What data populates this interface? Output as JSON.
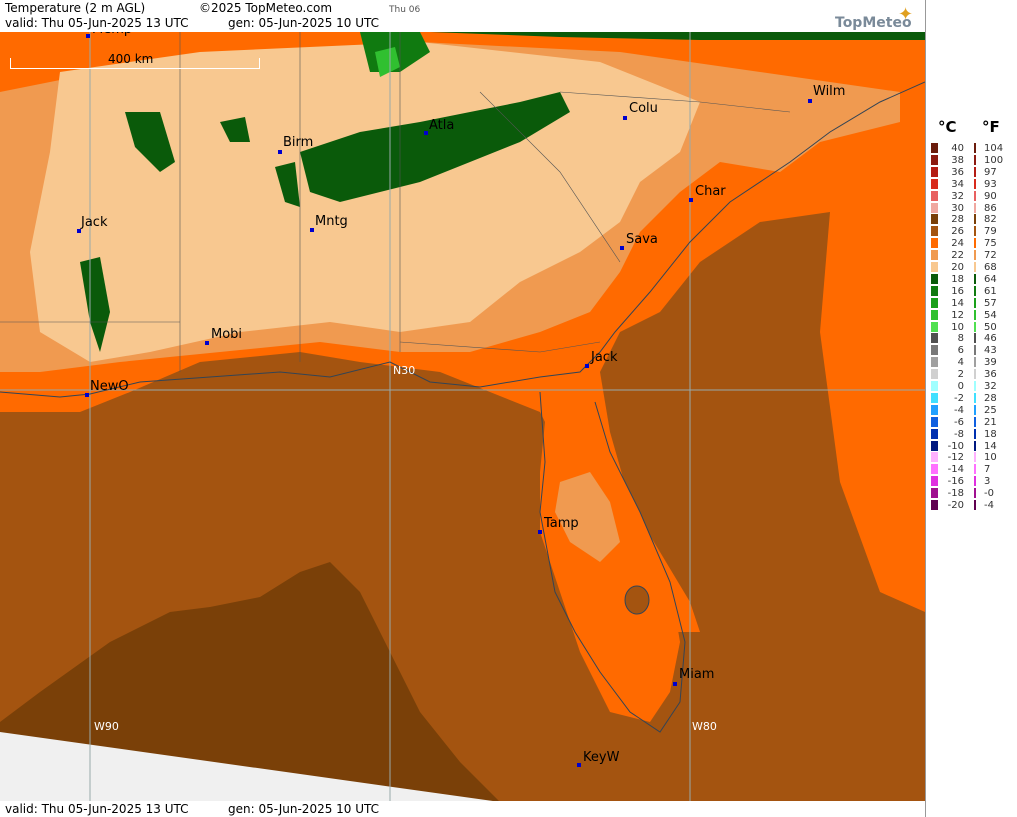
{
  "header": {
    "title": "Temperature (2 m AGL)",
    "copyright": "©2025 TopMeteo.com",
    "day_tab": "Thu 06",
    "valid": "valid:  Thu   05-Jun-2025  13 UTC",
    "generated": "gen:  05-Jun-2025 10 UTC",
    "brand": "TopMeteo"
  },
  "footer": {
    "valid": "valid:  Thu   05-Jun-2025  13 UTC",
    "generated": "gen:  05-Jun-2025 10 UTC"
  },
  "scale": {
    "label": "400 km"
  },
  "grid_labels": {
    "lat30": "N30",
    "lon90": "W90",
    "lon80": "W80"
  },
  "cities": [
    {
      "id": "memp",
      "name": "Memp"
    },
    {
      "id": "birm",
      "name": "Birm"
    },
    {
      "id": "atla",
      "name": "Atla"
    },
    {
      "id": "colu",
      "name": "Colu"
    },
    {
      "id": "wilm",
      "name": "Wilm"
    },
    {
      "id": "char",
      "name": "Char"
    },
    {
      "id": "jack-ms",
      "name": "Jack"
    },
    {
      "id": "mntg",
      "name": "Mntg"
    },
    {
      "id": "sava",
      "name": "Sava"
    },
    {
      "id": "mobi",
      "name": "Mobi"
    },
    {
      "id": "jack-fl",
      "name": "Jack"
    },
    {
      "id": "newo",
      "name": "NewO"
    },
    {
      "id": "tamp",
      "name": "Tamp"
    },
    {
      "id": "miam",
      "name": "Miam"
    },
    {
      "id": "keyw",
      "name": "KeyW"
    }
  ],
  "legend": {
    "unit_c": "°C",
    "unit_f": "°F",
    "rows": [
      {
        "c": "40",
        "f": "104",
        "color": "#6b1c0c"
      },
      {
        "c": "38",
        "f": "100",
        "color": "#8c1a10"
      },
      {
        "c": "36",
        "f": "97",
        "color": "#b41c14"
      },
      {
        "c": "34",
        "f": "93",
        "color": "#d82a1c"
      },
      {
        "c": "32",
        "f": "90",
        "color": "#e86060"
      },
      {
        "c": "30",
        "f": "86",
        "color": "#f0a8a0"
      },
      {
        "c": "28",
        "f": "82",
        "color": "#7a4008"
      },
      {
        "c": "26",
        "f": "79",
        "color": "#a45410"
      },
      {
        "c": "24",
        "f": "75",
        "color": "#ff6a00"
      },
      {
        "c": "22",
        "f": "72",
        "color": "#f09a50"
      },
      {
        "c": "20",
        "f": "68",
        "color": "#f8c890"
      },
      {
        "c": "18",
        "f": "64",
        "color": "#0a5a0a"
      },
      {
        "c": "16",
        "f": "61",
        "color": "#107a10"
      },
      {
        "c": "14",
        "f": "57",
        "color": "#1aa01a"
      },
      {
        "c": "12",
        "f": "54",
        "color": "#30c030"
      },
      {
        "c": "10",
        "f": "50",
        "color": "#50e050"
      },
      {
        "c": "8",
        "f": "46",
        "color": "#505050"
      },
      {
        "c": "6",
        "f": "43",
        "color": "#787878"
      },
      {
        "c": "4",
        "f": "39",
        "color": "#a0a0a0"
      },
      {
        "c": "2",
        "f": "36",
        "color": "#d0d0d0"
      },
      {
        "c": "0",
        "f": "32",
        "color": "#a0ffff"
      },
      {
        "c": "-2",
        "f": "28",
        "color": "#40e0ff"
      },
      {
        "c": "-4",
        "f": "25",
        "color": "#20a0ff"
      },
      {
        "c": "-6",
        "f": "21",
        "color": "#1060e0"
      },
      {
        "c": "-8",
        "f": "18",
        "color": "#0030b0"
      },
      {
        "c": "-10",
        "f": "14",
        "color": "#001880"
      },
      {
        "c": "-12",
        "f": "10",
        "color": "#ffb0ff"
      },
      {
        "c": "-14",
        "f": "7",
        "color": "#ff70ff"
      },
      {
        "c": "-16",
        "f": "3",
        "color": "#e030e0"
      },
      {
        "c": "-18",
        "f": "-0",
        "color": "#a01090"
      },
      {
        "c": "-20",
        "f": "-4",
        "color": "#600050"
      }
    ]
  },
  "colors": {
    "sea_dark": "#7a4008",
    "sea": "#a45410",
    "orange": "#ff6a00",
    "light_orange": "#f09a50",
    "peach": "#f8c890",
    "green": "#0a5a0a",
    "bright_green": "#30c030"
  }
}
